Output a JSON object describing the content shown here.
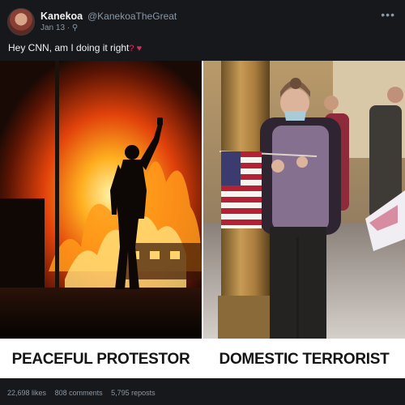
{
  "post": {
    "display_name": "Kanekoa",
    "handle": "@KanekoaTheGreat",
    "date": "Jan 13 · ⚲",
    "text": "Hey CNN, am I doing it right",
    "text_emoji": "? ♥",
    "more_icon": "ellipsis-icon"
  },
  "meme": {
    "left_caption": "PEACEFUL PROTESTOR",
    "right_caption": "DOMESTIC TERRORIST"
  },
  "stats": {
    "likes": "22,698 likes",
    "comments": "808 comments",
    "reposts": "5,795 reposts"
  }
}
